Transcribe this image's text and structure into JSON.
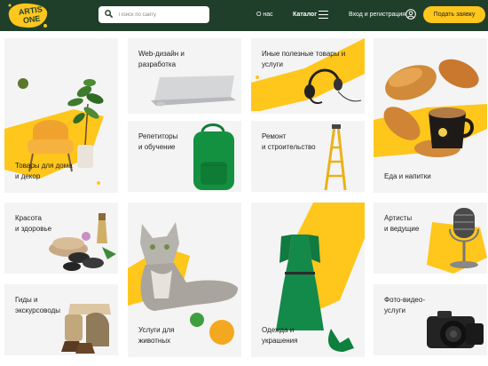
{
  "header": {
    "logo_text": "ARTIS ONE",
    "search_placeholder": "Поиск по сайту",
    "nav_about": "О нас",
    "nav_catalog": "Каталог",
    "login": "Вход и регистрация",
    "apply_button": "Подать заявку"
  },
  "categories": [
    {
      "label_1": "Товары для дома",
      "label_2": "и декор"
    },
    {
      "label_1": "Web-дизайн и",
      "label_2": "разработка"
    },
    {
      "label_1": "Иные полезные товары и",
      "label_2": "услуги"
    },
    {
      "label_1": "Еда и напитки",
      "label_2": ""
    },
    {
      "label_1": "Репетиторы",
      "label_2": "и обучение"
    },
    {
      "label_1": "Ремонт",
      "label_2": "и строительство"
    },
    {
      "label_1": "Красота",
      "label_2": "и здоровье"
    },
    {
      "label_1": "Артисты",
      "label_2": "и ведущие"
    },
    {
      "label_1": "Услуги для",
      "label_2": "животных"
    },
    {
      "label_1": "Одежда и",
      "label_2": "украшения"
    },
    {
      "label_1": "Гиды и",
      "label_2": "экскурсоводы"
    },
    {
      "label_1": "Фото-видео-",
      "label_2": "услуги"
    }
  ],
  "colors": {
    "header_bg": "#1f3f2b",
    "accent_yellow": "#ffc61c",
    "card_bg": "#f4f4f4"
  }
}
